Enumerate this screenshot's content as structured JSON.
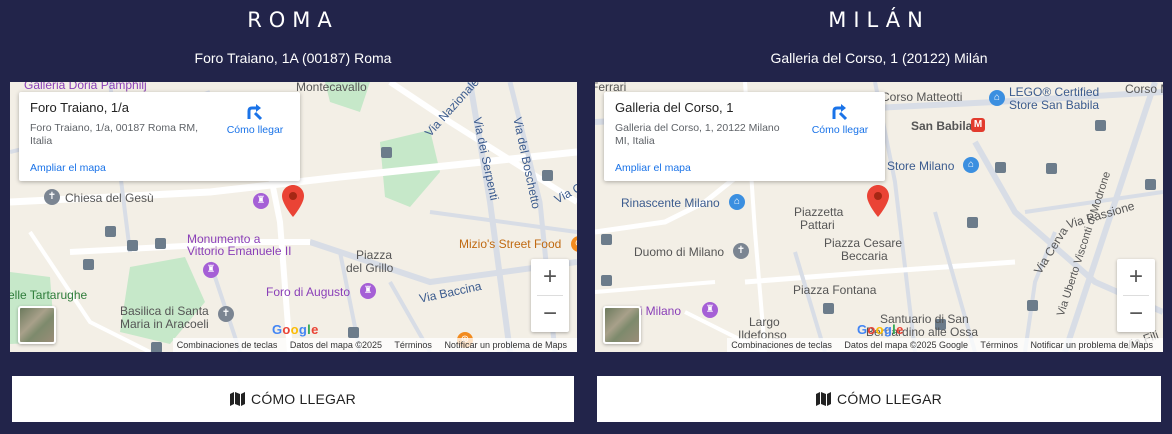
{
  "roma": {
    "city": "ROMA",
    "address": "Foro Traiano, 1A (00187) Roma",
    "map": {
      "place_title": "Foro Traiano, 1/a",
      "place_address": "Foro Traiano, 1/a, 00187 Roma RM, Italia",
      "directions_label": "Cómo llegar",
      "expand_label": "Ampliar el mapa",
      "labels": {
        "doria": "Galleria Doria Pamphilj",
        "montecavallo": "Montecavallo",
        "via_nazionale": "Via Nazionale",
        "via_serpenti": "Via dei Serpenti",
        "via_boschetto": "Via del Boschetto",
        "via_cim": "Via Cim",
        "chiesa": "Chiesa del Gesù",
        "monumento1": "Monumento a",
        "monumento2": "Vittorio Emanuele II",
        "mizio": "Mizio's Street Food",
        "piazza_grillo1": "Piazza",
        "piazza_grillo2": "del Grillo",
        "via_baccina": "Via Baccina",
        "tartarughe": "elle Tartarughe",
        "foro_augusto": "Foro di Augusto",
        "basilica1": "Basilica di Santa",
        "basilica2": "Maria in Aracoeli"
      },
      "keyboard_label": "Combinaciones de teclas",
      "map_data_label": "Datos del mapa ©2025",
      "terms_label": "Términos",
      "report_label": "Notificar un problema de Maps"
    },
    "button_label": "CÓMO LLEGAR"
  },
  "milan": {
    "city": "MILÁN",
    "address": "Galleria del Corso, 1 (20122) Milán",
    "map": {
      "place_title": "Galleria del Corso, 1",
      "place_address": "Galleria del Corso, 1, 20122 Milano MI, Italia",
      "directions_label": "Cómo llegar",
      "expand_label": "Ampliar el mapa",
      "labels": {
        "ferrari": "Ferrari",
        "corso_matteotti": "Corso Matteotti",
        "lego1": "LEGO® Certified",
        "lego2": "Store San Babila",
        "corso_mo": "Corso Mo",
        "san_babila": "San Babila",
        "store_milano": "Store Milano",
        "rinascente": "Rinascente Milano",
        "piazzetta1": "Piazzetta",
        "piazzetta2": "Pattari",
        "via_passione": "Via Passione",
        "duomo": "Duomo di Milano",
        "piazza_cesare1": "Piazza Cesare",
        "piazza_cesare2": "Beccaria",
        "via_cerva": "Via Cerva",
        "via_uberto": "Via Uberto Visconti di Modrone",
        "piazza_fontana": "Piazza Fontana",
        "museo": "di Milano",
        "largo1": "Largo",
        "largo2": "Ildefonso",
        "santuario1": "Santuario di San",
        "santuario2": "Bernardino alle Ossa",
        "via_fili": "Via Fili"
      },
      "keyboard_label": "Combinaciones de teclas",
      "map_data_label": "Datos del mapa ©2025 Google",
      "terms_label": "Términos",
      "report_label": "Notificar un problema de Maps"
    },
    "button_label": "CÓMO LLEGAR"
  },
  "google_logo": "Google",
  "colors": {
    "page_bg": "#22244a",
    "accent_blue": "#1a73e8",
    "pin_red": "#ea4335"
  }
}
